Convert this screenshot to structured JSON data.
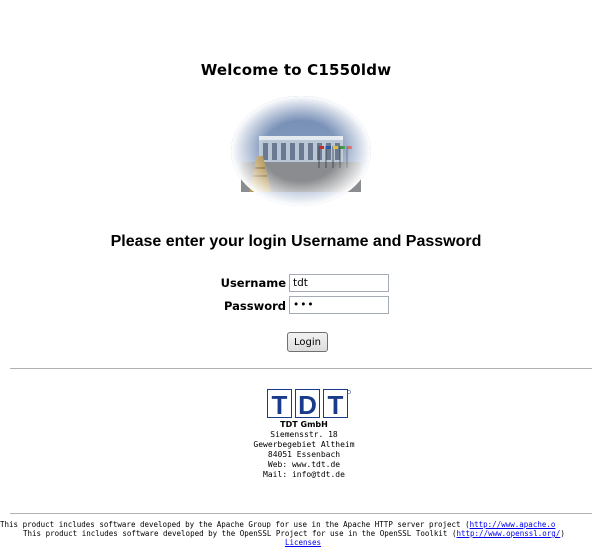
{
  "header": {
    "title": "Welcome to C1550ldw"
  },
  "login": {
    "prompt": "Please enter your login Username and Password",
    "username_label": "Username",
    "username_value": "tdt",
    "password_label": "Password",
    "password_value": "•••",
    "button_label": "Login"
  },
  "company": {
    "logo_text": "TDT",
    "name": "TDT GmbH",
    "street": "Siemensstr. 18",
    "area": "Gewerbegebiet Altheim",
    "city": "84051 Essenbach",
    "web": "Web: www.tdt.de",
    "mail": "Mail: info@tdt.de"
  },
  "footer": {
    "apache_text": "This product includes software developed by the Apache Group for use in the Apache HTTP server project (",
    "apache_link": "http://www.apache.o",
    "openssl_text": "This product includes software developed by the OpenSSL Project for use in the OpenSSL Toolkit (",
    "openssl_link": "http://www.openssl.org/",
    "openssl_end": ")",
    "licenses_link": "Licenses"
  },
  "colors": {
    "link": "#0000ee",
    "logo_blue": "#1a3a8c"
  }
}
